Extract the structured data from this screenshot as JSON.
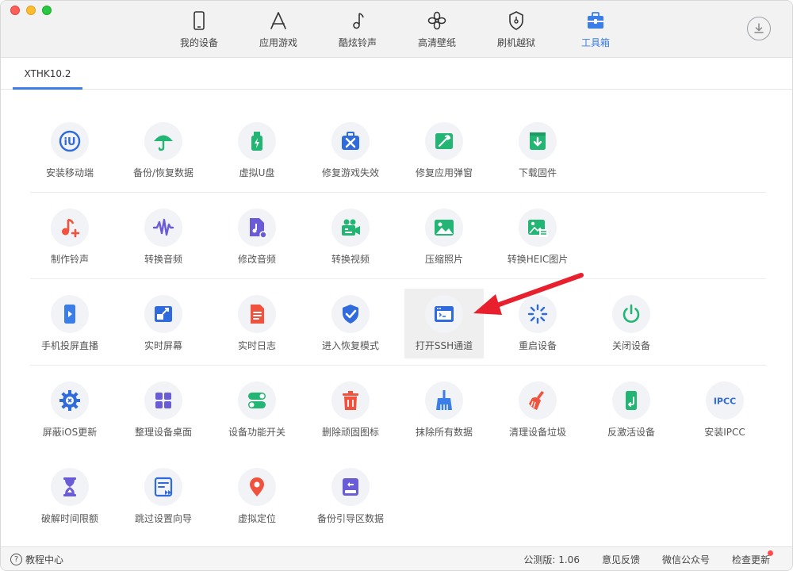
{
  "nav": {
    "items": [
      {
        "label": "我的设备",
        "icon": "phone-icon"
      },
      {
        "label": "应用游戏",
        "icon": "app-store-icon"
      },
      {
        "label": "酷炫铃声",
        "icon": "music-note-icon"
      },
      {
        "label": "高清壁纸",
        "icon": "flower-icon"
      },
      {
        "label": "刷机越狱",
        "icon": "lock-shield-icon"
      },
      {
        "label": "工具箱",
        "icon": "toolbox-icon",
        "active": true
      }
    ]
  },
  "device_tab": "XTHK10.2",
  "tools": [
    {
      "label": "安装移动端",
      "icon": "install-app-icon"
    },
    {
      "label": "备份/恢复数据",
      "icon": "umbrella-icon"
    },
    {
      "label": "虚拟U盘",
      "icon": "usb-drive-icon"
    },
    {
      "label": "修复游戏失效",
      "icon": "repair-game-icon"
    },
    {
      "label": "修复应用弹窗",
      "icon": "repair-app-icon"
    },
    {
      "label": "下载固件",
      "icon": "download-firmware-icon"
    },
    {
      "label": "制作铃声",
      "icon": "make-ringtone-icon"
    },
    {
      "label": "转换音频",
      "icon": "audio-wave-icon"
    },
    {
      "label": "修改音频",
      "icon": "edit-audio-icon"
    },
    {
      "label": "转换视频",
      "icon": "video-camera-icon"
    },
    {
      "label": "压缩照片",
      "icon": "compress-photo-icon"
    },
    {
      "label": "转换HEIC图片",
      "icon": "convert-heic-icon"
    },
    {
      "label": "手机投屏直播",
      "icon": "screen-mirror-icon"
    },
    {
      "label": "实时屏幕",
      "icon": "realtime-screen-icon"
    },
    {
      "label": "实时日志",
      "icon": "log-document-icon"
    },
    {
      "label": "进入恢复模式",
      "icon": "recovery-shield-icon"
    },
    {
      "label": "打开SSH通道",
      "icon": "terminal-icon",
      "highlighted": true
    },
    {
      "label": "重启设备",
      "icon": "restart-spinner-icon"
    },
    {
      "label": "关闭设备",
      "icon": "power-icon"
    },
    {
      "label": "屏蔽iOS更新",
      "icon": "block-update-gear-icon"
    },
    {
      "label": "整理设备桌面",
      "icon": "grid-tiles-icon"
    },
    {
      "label": "设备功能开关",
      "icon": "toggle-switch-icon"
    },
    {
      "label": "删除顽固图标",
      "icon": "trash-icon"
    },
    {
      "label": "抹除所有数据",
      "icon": "broom-icon"
    },
    {
      "label": "清理设备垃圾",
      "icon": "clean-junk-icon"
    },
    {
      "label": "反激活设备",
      "icon": "deactivate-phone-icon"
    },
    {
      "label": "安装IPCC",
      "icon": "ipcc-icon",
      "icon_text": "IPCC"
    },
    {
      "label": "破解时间限额",
      "icon": "hourglass-icon"
    },
    {
      "label": "跳过设置向导",
      "icon": "skip-wizard-icon"
    },
    {
      "label": "虚拟定位",
      "icon": "location-pin-icon"
    },
    {
      "label": "备份引导区数据",
      "icon": "backup-boot-icon"
    }
  ],
  "status": {
    "help": "教程中心",
    "version": "公测版: 1.06",
    "feedback": "意见反馈",
    "wechat": "微信公众号",
    "update": "检查更新"
  },
  "colors": {
    "accent": "#3b7ee8",
    "annotation": "#e8202e"
  }
}
